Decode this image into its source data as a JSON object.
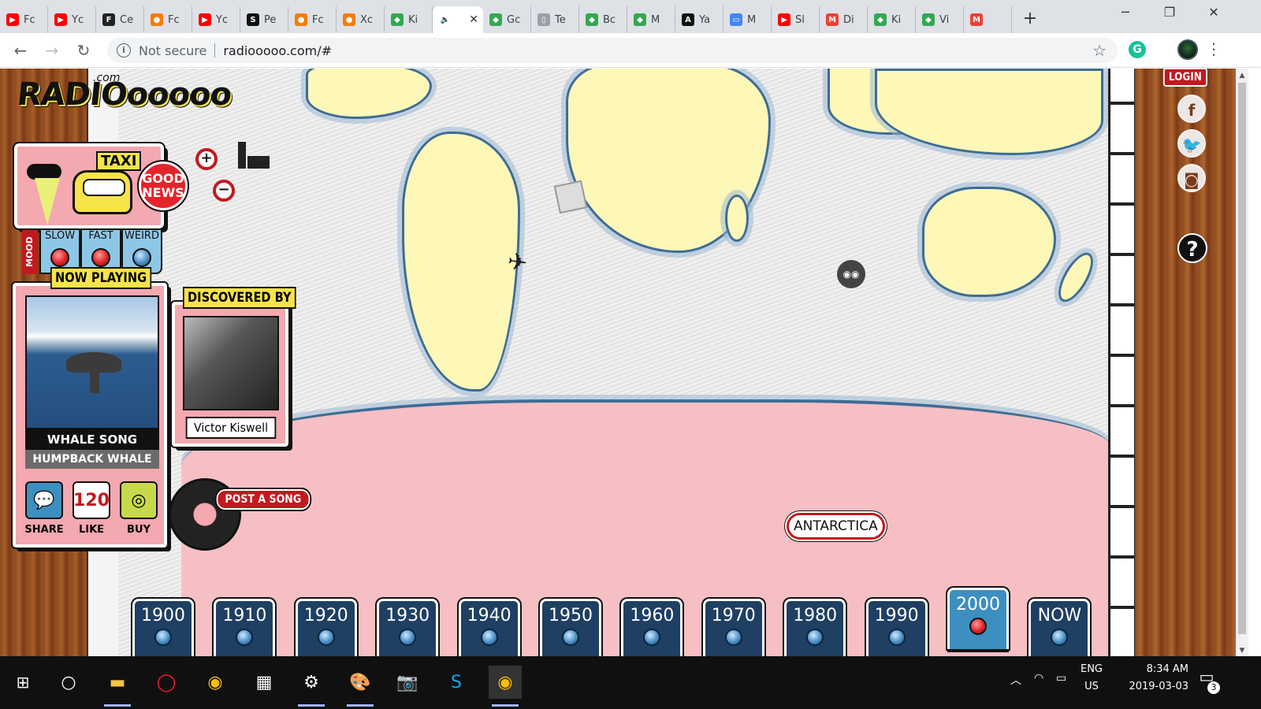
{
  "browser": {
    "tabs": [
      {
        "label": "Fc",
        "icon": "youtube-icon",
        "color": "#ff0000",
        "glyph": "▶"
      },
      {
        "label": "Yc",
        "icon": "youtube-icon",
        "color": "#ff0000",
        "glyph": "▶"
      },
      {
        "label": "Ce",
        "icon": "f-icon",
        "color": "#222222",
        "glyph": "F"
      },
      {
        "label": "Fc",
        "icon": "orange-icon",
        "color": "#f57c00",
        "glyph": "●"
      },
      {
        "label": "Yc",
        "icon": "youtube-icon",
        "color": "#ff0000",
        "glyph": "▶"
      },
      {
        "label": "Pe",
        "icon": "s-icon",
        "color": "#111111",
        "glyph": "S"
      },
      {
        "label": "Fc",
        "icon": "orange-icon",
        "color": "#f57c00",
        "glyph": "●"
      },
      {
        "label": "Xc",
        "icon": "orange-icon",
        "color": "#f57c00",
        "glyph": "●"
      },
      {
        "label": "Ki",
        "icon": "maps-icon",
        "color": "#34a853",
        "glyph": "◆"
      },
      {
        "label": "",
        "icon": "speaker-icon",
        "color": "#ffffff",
        "glyph": "🔈",
        "active": true
      },
      {
        "label": "Gc",
        "icon": "maps-icon",
        "color": "#34a853",
        "glyph": "◆"
      },
      {
        "label": "Te",
        "icon": "doc-icon",
        "color": "#9aa0a6",
        "glyph": "▯"
      },
      {
        "label": "Bc",
        "icon": "maps-icon",
        "color": "#34a853",
        "glyph": "◆"
      },
      {
        "label": "M",
        "icon": "maps-icon",
        "color": "#34a853",
        "glyph": "◆"
      },
      {
        "label": "Ya",
        "icon": "ac-icon",
        "color": "#111111",
        "glyph": "A"
      },
      {
        "label": "M",
        "icon": "chat-icon",
        "color": "#4285f4",
        "glyph": "▭"
      },
      {
        "label": "Sl",
        "icon": "youtube-icon",
        "color": "#ff0000",
        "glyph": "▶"
      },
      {
        "label": "Di",
        "icon": "gmail-icon",
        "color": "#ea4335",
        "glyph": "M"
      },
      {
        "label": "Ki",
        "icon": "maps-icon",
        "color": "#34a853",
        "glyph": "◆"
      },
      {
        "label": "Vi",
        "icon": "maps-icon",
        "color": "#34a853",
        "glyph": "◆"
      },
      {
        "label": "",
        "icon": "gmail-icon",
        "color": "#ea4335",
        "glyph": "M"
      }
    ],
    "not_secure": "Not secure",
    "url": "radiooooo.com/#"
  },
  "site": {
    "logo": "RADIOooooo",
    "logo_com": ".com",
    "taxi": "TAXI",
    "good_news": "GOOD NEWS",
    "mood_label": "MOOD",
    "moods": [
      "SLOW",
      "FAST",
      "WEIRD"
    ],
    "now_playing": "NOW PLAYING",
    "song_title": "WHALE SONG",
    "song_artist": "HUMPBACK WHALE",
    "actions": {
      "share": "SHARE",
      "like": "LIKE",
      "like_count": "120",
      "buy": "BUY"
    },
    "discovered_by": "DISCOVERED BY",
    "discoverer": "Victor Kiswell",
    "post_song": "POST A SONG",
    "map_label": "ANTARCTICA",
    "login": "LOGIN",
    "help": "?",
    "decades": [
      "1900",
      "1910",
      "1920",
      "1930",
      "1940",
      "1950",
      "1960",
      "1970",
      "1980",
      "1990",
      "2000",
      "NOW"
    ],
    "active_decade": "2000"
  },
  "taskbar": {
    "lang": "ENG",
    "region": "US",
    "time": "8:34 AM",
    "date": "2019-03-03",
    "notifications": "3"
  },
  "colors": {
    "accent_red": "#c2191f",
    "decade_blue": "#1f3f63",
    "active_blue": "#3d8fc0",
    "antarctica_pink": "#f6bfc4",
    "panel_pink": "#f4a8b0",
    "label_yellow": "#f7e34a"
  }
}
